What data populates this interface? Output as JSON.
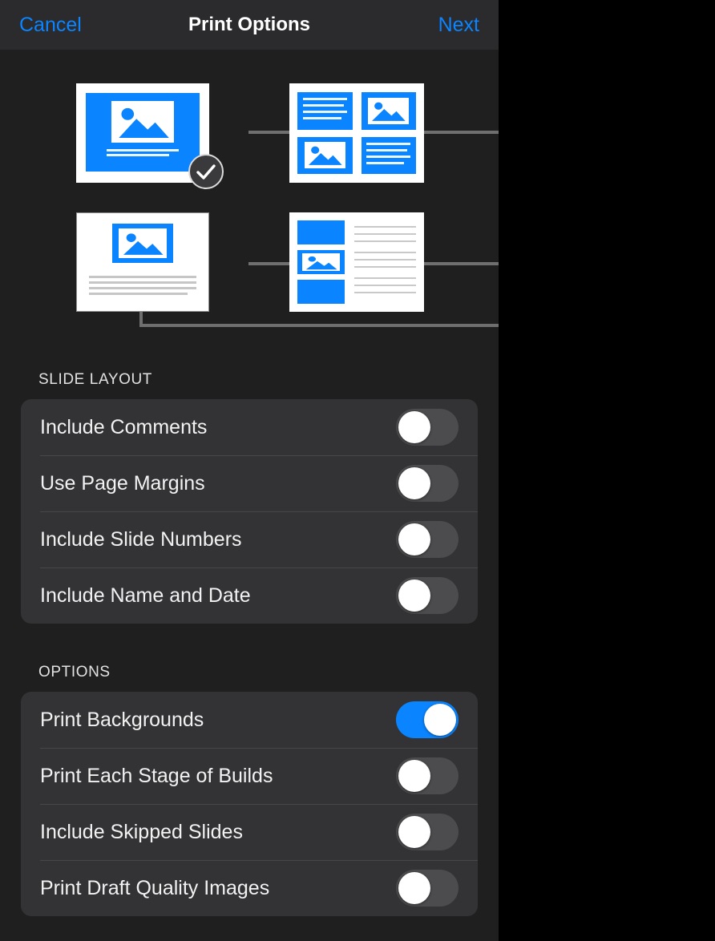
{
  "navbar": {
    "cancel_label": "Cancel",
    "title": "Print Options",
    "next_label": "Next"
  },
  "layouts": {
    "selected_index": 0,
    "items": [
      {
        "name": "slide-only-layout",
        "selected": true
      },
      {
        "name": "four-up-grid-layout",
        "selected": false
      },
      {
        "name": "slide-with-notes-layout",
        "selected": false
      },
      {
        "name": "handout-three-up-layout",
        "selected": false
      }
    ]
  },
  "sections": [
    {
      "header": "SLIDE LAYOUT",
      "rows": [
        {
          "label": "Include Comments",
          "on": false
        },
        {
          "label": "Use Page Margins",
          "on": false
        },
        {
          "label": "Include Slide Numbers",
          "on": false
        },
        {
          "label": "Include Name and Date",
          "on": false
        }
      ]
    },
    {
      "header": "OPTIONS",
      "rows": [
        {
          "label": "Print Backgrounds",
          "on": true
        },
        {
          "label": "Print Each Stage of Builds",
          "on": false
        },
        {
          "label": "Include Skipped Slides",
          "on": false
        },
        {
          "label": "Print Draft Quality Images",
          "on": false
        }
      ]
    }
  ],
  "colors": {
    "accent": "#0a84ff",
    "panel_bg": "#1f1f1f",
    "navbar_bg": "#2b2b2d",
    "card_bg": "#333335",
    "switch_off": "#4c4c4e",
    "text": "#f2f2f2",
    "connector": "#6f6f6f"
  }
}
